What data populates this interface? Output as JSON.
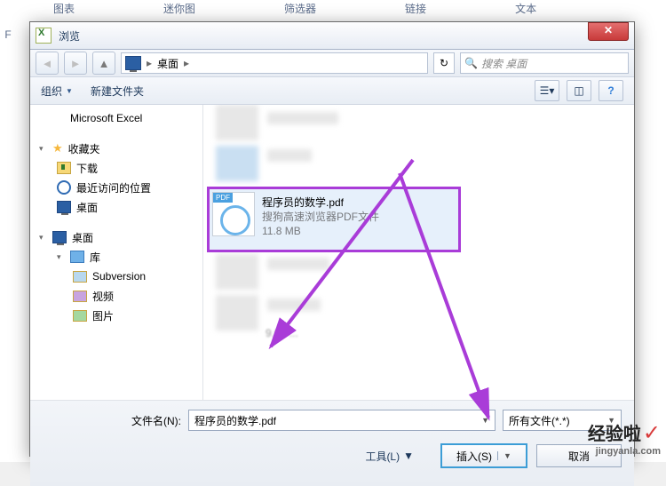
{
  "ribbon": {
    "t1": "图表",
    "t2": "迷你图",
    "t3": "筛选器",
    "t4": "链接",
    "t5": "文本"
  },
  "rowhead": "F",
  "dialog": {
    "title": "浏览",
    "crumb_loc": "桌面",
    "crumb_sep": "▸",
    "refresh_glyph": "↻",
    "search_placeholder": "搜索 桌面"
  },
  "toolbar": {
    "org": "组织",
    "newf": "新建文件夹",
    "help": "?"
  },
  "tree": {
    "excel": "Microsoft Excel",
    "fav": "收藏夹",
    "downloads": "下载",
    "recent": "最近访问的位置",
    "desktop1": "桌面",
    "desktop2": "桌面",
    "lib": "库",
    "svn": "Subversion",
    "video": "视频",
    "pic": "图片"
  },
  "file": {
    "name": "程序员的数学.pdf",
    "type": "搜狗高速浏览器PDF文件",
    "size": "11.8 MB",
    "ghost_size": "9.04 ..."
  },
  "bottom": {
    "fname_label": "文件名(N):",
    "fname_value": "程序员的数学.pdf",
    "filter": "所有文件(*.*)",
    "tools": "工具(L)",
    "insert": "插入(S)",
    "cancel": "取消"
  },
  "watermark": {
    "l1": "经验啦",
    "l2": "jingyanla.com"
  }
}
